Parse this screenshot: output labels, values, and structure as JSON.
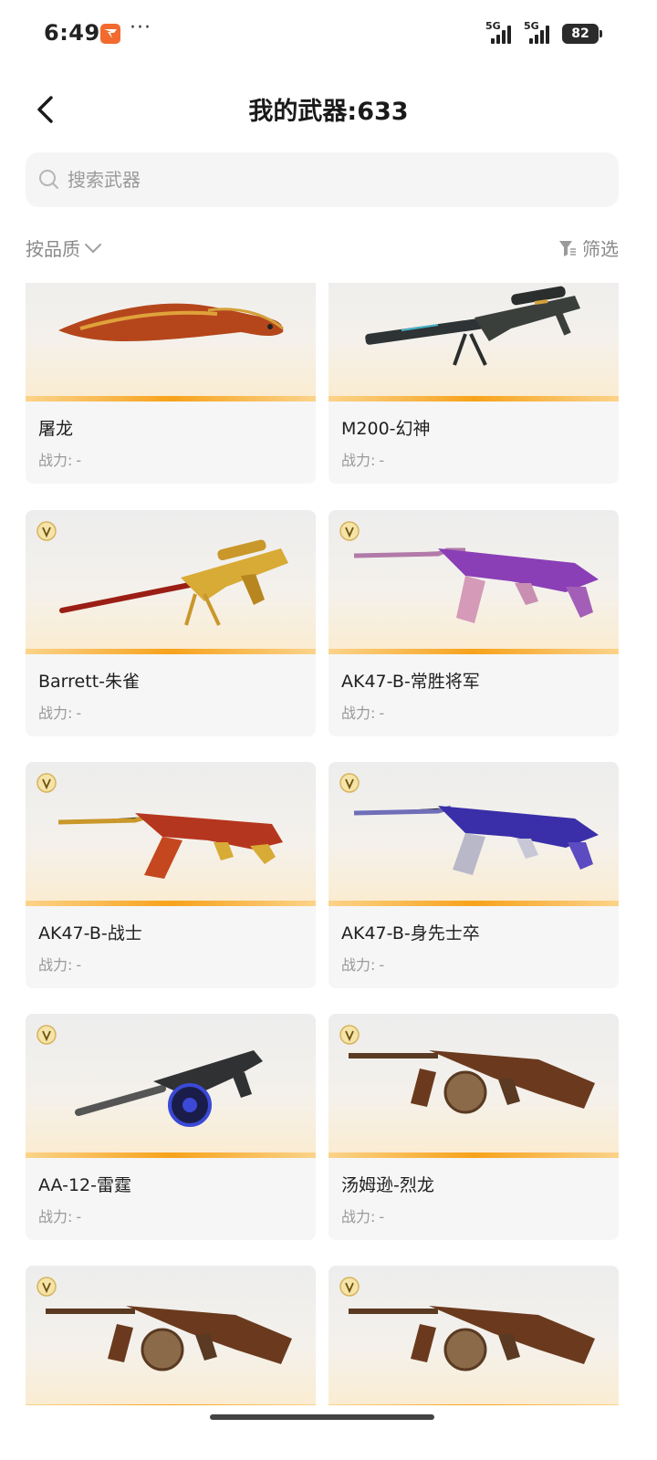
{
  "status_bar": {
    "time": "6:49",
    "dots": "···",
    "signal_1": "5G",
    "signal_2": "5G",
    "battery": "82"
  },
  "header": {
    "title": "我的武器:633"
  },
  "search": {
    "placeholder": "搜索武器",
    "value": ""
  },
  "sort": {
    "label": "按品质"
  },
  "filter": {
    "label": "筛选"
  },
  "power_label": "战力:",
  "power_empty": "-",
  "weapons": [
    {
      "name": "屠龙",
      "power": "-",
      "type": "knife"
    },
    {
      "name": "M200-幻神",
      "power": "-",
      "type": "sniper-dark"
    },
    {
      "name": "Barrett-朱雀",
      "power": "-",
      "type": "sniper-gold"
    },
    {
      "name": "AK47-B-常胜将军",
      "power": "-",
      "type": "ak-purple"
    },
    {
      "name": "AK47-B-战士",
      "power": "-",
      "type": "ak-gold"
    },
    {
      "name": "AK47-B-身先士卒",
      "power": "-",
      "type": "ak-blue"
    },
    {
      "name": "AA-12-雷霆",
      "power": "-",
      "type": "shotgun"
    },
    {
      "name": "汤姆逊-烈龙",
      "power": "-",
      "type": "tommy"
    },
    {
      "name": "",
      "power": "",
      "type": "tommy"
    },
    {
      "name": "",
      "power": "",
      "type": "tommy"
    }
  ],
  "colors": {
    "accent_orange": "#f7a21b",
    "app_icon": "#f26a2e",
    "text_primary": "#1a1a1a",
    "text_secondary": "#999999"
  }
}
